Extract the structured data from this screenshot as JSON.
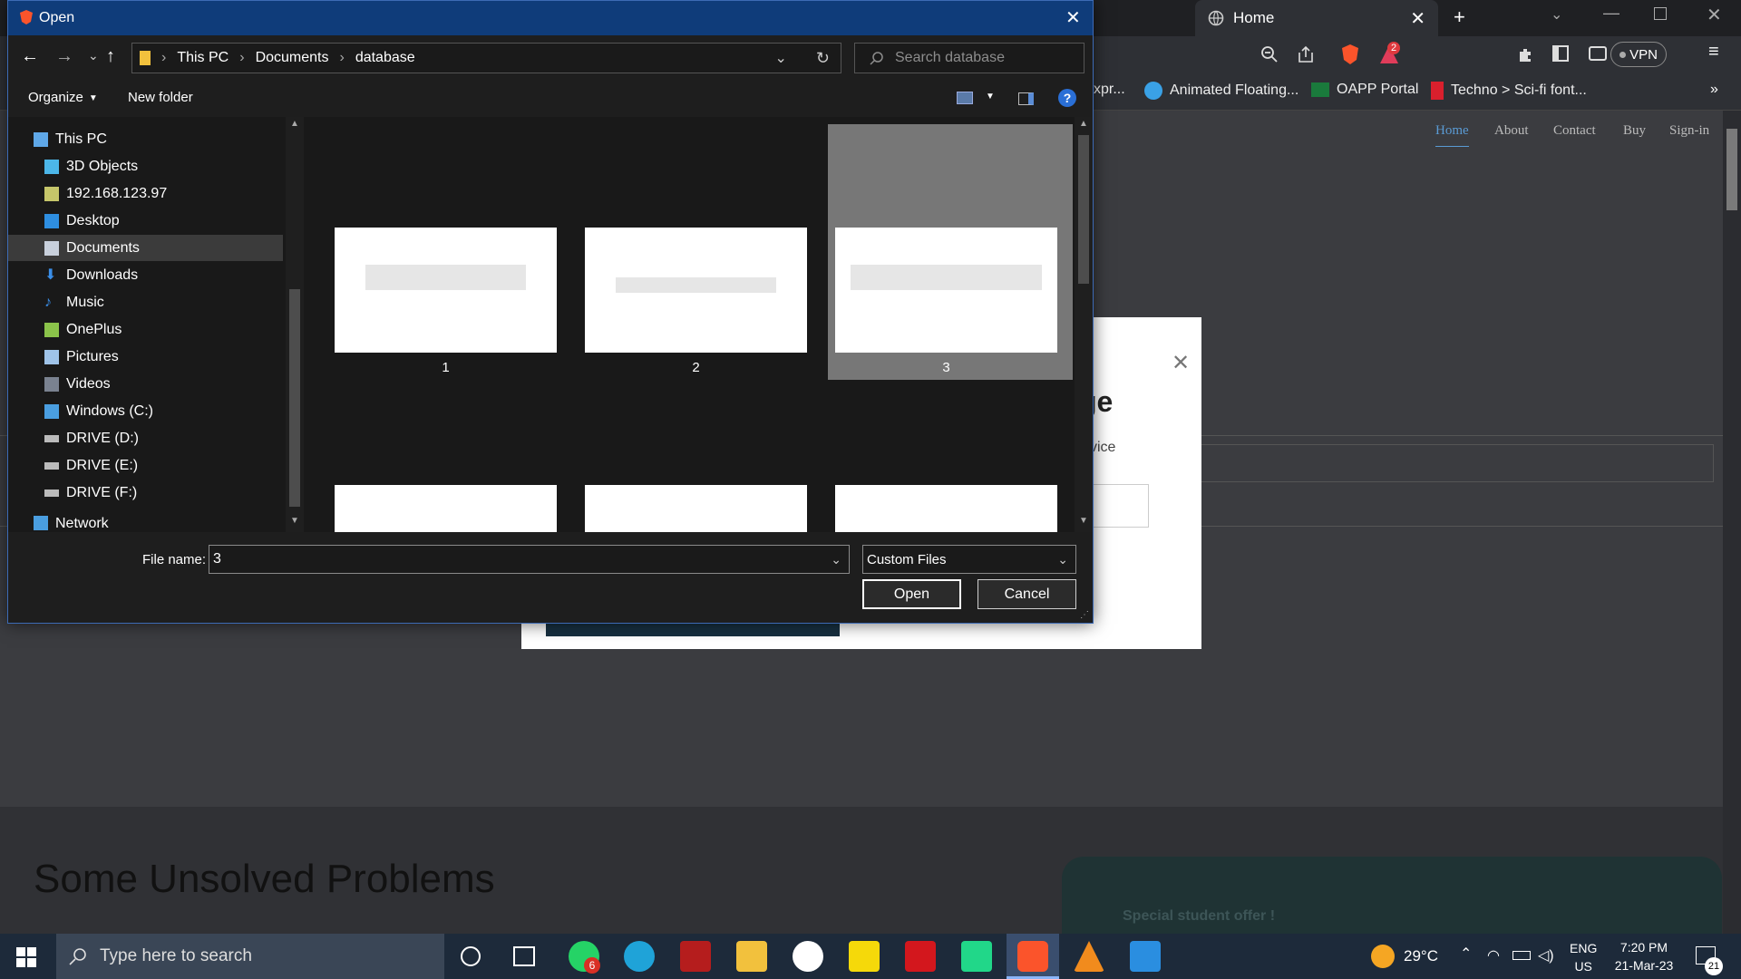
{
  "browser": {
    "tab_title": "Home",
    "vpn_label": "VPN",
    "bookmarks": [
      "xpr...",
      "Animated Floating...",
      "OAPP Portal",
      "Techno > Sci-fi font..."
    ],
    "nav": [
      "Home",
      "About",
      "Contact",
      "Buy",
      "Sign-in"
    ],
    "brave_badge": "2"
  },
  "webpage": {
    "modal_heading_fragment": "ge",
    "modal_text_fragment": "vice",
    "section_heading": "Some Unsolved Problems",
    "offer_text": "Special student offer !"
  },
  "dialog": {
    "title": "Open",
    "breadcrumb": [
      "This PC",
      "Documents",
      "database"
    ],
    "search_placeholder": "Search database",
    "organize_label": "Organize",
    "new_folder_label": "New folder",
    "tree": [
      {
        "label": "This PC",
        "icon": "pc-icon"
      },
      {
        "label": "3D Objects",
        "icon": "cube-icon"
      },
      {
        "label": "192.168.123.97",
        "icon": "network-drive-icon"
      },
      {
        "label": "Desktop",
        "icon": "desktop-icon"
      },
      {
        "label": "Documents",
        "icon": "documents-icon",
        "selected": true
      },
      {
        "label": "Downloads",
        "icon": "download-icon"
      },
      {
        "label": "Music",
        "icon": "music-icon"
      },
      {
        "label": "OnePlus",
        "icon": "device-icon"
      },
      {
        "label": "Pictures",
        "icon": "pictures-icon"
      },
      {
        "label": "Videos",
        "icon": "videos-icon"
      },
      {
        "label": "Windows (C:)",
        "icon": "windows-drive-icon"
      },
      {
        "label": "DRIVE (D:)",
        "icon": "drive-icon"
      },
      {
        "label": "DRIVE (E:)",
        "icon": "drive-icon"
      },
      {
        "label": "DRIVE (F:)",
        "icon": "drive-icon"
      },
      {
        "label": "Network",
        "icon": "network-icon"
      }
    ],
    "files": [
      "1",
      "2",
      "3"
    ],
    "selected_file": "3",
    "file_name_label": "File name:",
    "file_name_value": "3",
    "file_type": "Custom Files",
    "open_label": "Open",
    "cancel_label": "Cancel",
    "accent_color": "#0f3c7a"
  },
  "taskbar": {
    "search_placeholder": "Type here to search",
    "whatsapp_badge": "6",
    "weather": "29°C",
    "lang": "ENG",
    "region": "US",
    "time": "7:20 PM",
    "date": "21-Mar-23",
    "notifications": "21"
  }
}
